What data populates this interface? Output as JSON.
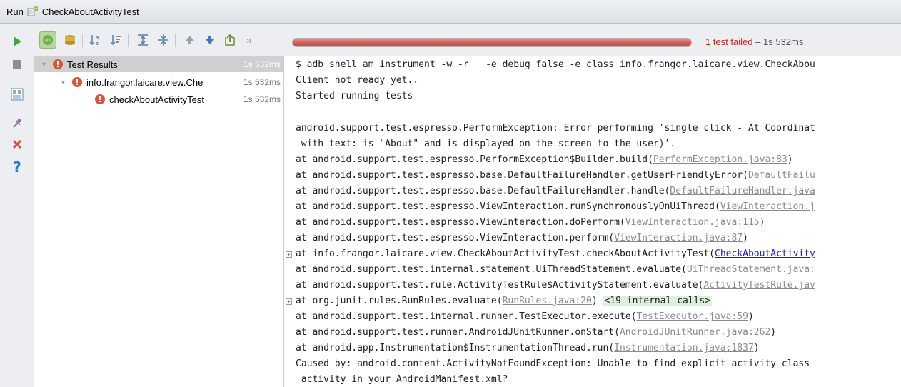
{
  "titlebar": {
    "run_label": "Run",
    "config_name": "CheckAboutActivityTest"
  },
  "toolbar": {
    "more_glyph": "»"
  },
  "status": {
    "failed_text": "1 test failed",
    "timing_text": " – 1s 532ms",
    "progress": 1.0
  },
  "tree": {
    "root": {
      "label": "Test Results",
      "ms": "1s 532ms"
    },
    "cls": {
      "label": "info.frangor.laicare.view.Che",
      "ms": "1s 532ms"
    },
    "method": {
      "label": "checkAboutActivityTest",
      "ms": "1s 532ms"
    }
  },
  "console": {
    "l0": "$ adb shell am instrument -w -r   -e debug false -e class info.frangor.laicare.view.CheckAbou",
    "l1": "Client not ready yet..",
    "l2": "Started running tests",
    "l3": "android.support.test.espresso.PerformException: Error performing 'single click - At Coordinat",
    "l4": " with text: is \"About\" and is displayed on the screen to the user)'.",
    "l5": {
      "text": "at android.support.test.espresso.PerformException$Builder.build(",
      "link": "PerformException.java:83",
      "tail": ")"
    },
    "l6": {
      "text": "at android.support.test.espresso.base.DefaultFailureHandler.getUserFriendlyError(",
      "link": "DefaultFailu",
      "tail": ""
    },
    "l7": {
      "text": "at android.support.test.espresso.base.DefaultFailureHandler.handle(",
      "link": "DefaultFailureHandler.java",
      "tail": ""
    },
    "l8": {
      "text": "at android.support.test.espresso.ViewInteraction.runSynchronouslyOnUiThread(",
      "link": "ViewInteraction.j",
      "tail": ""
    },
    "l9": {
      "text": "at android.support.test.espresso.ViewInteraction.doPerform(",
      "link": "ViewInteraction.java:115",
      "tail": ")"
    },
    "l10": {
      "text": "at android.support.test.espresso.ViewInteraction.perform(",
      "link": "ViewInteraction.java:87",
      "tail": ")"
    },
    "l11": {
      "text": "at info.frangor.laicare.view.CheckAboutActivityTest.checkAboutActivityTest(",
      "link": "CheckAboutActivity",
      "tail": ""
    },
    "l12": {
      "text": "at android.support.test.internal.statement.UiThreadStatement.evaluate(",
      "link": "UiThreadStatement.java:",
      "tail": ""
    },
    "l13": {
      "text": "at android.support.test.rule.ActivityTestRule$ActivityStatement.evaluate(",
      "link": "ActivityTestRule.jav",
      "tail": ""
    },
    "l14": {
      "text": "at org.junit.rules.RunRules.evaluate(",
      "link": "RunRules.java:20",
      "tail": ") ",
      "internal": "<19 internal calls>"
    },
    "l15": {
      "text": "at android.support.test.internal.runner.TestExecutor.execute(",
      "link": "TestExecutor.java:59",
      "tail": ")"
    },
    "l16": {
      "text": "at android.support.test.runner.AndroidJUnitRunner.onStart(",
      "link": "AndroidJUnitRunner.java:262",
      "tail": ")"
    },
    "l17": {
      "text": "at android.app.Instrumentation$InstrumentationThread.run(",
      "link": "Instrumentation.java:1837",
      "tail": ")"
    },
    "l18": "Caused by: android.content.ActivityNotFoundException: Unable to find explicit activity class",
    "l19": " activity in your AndroidManifest.xml?",
    "fold_glyph": "+"
  }
}
